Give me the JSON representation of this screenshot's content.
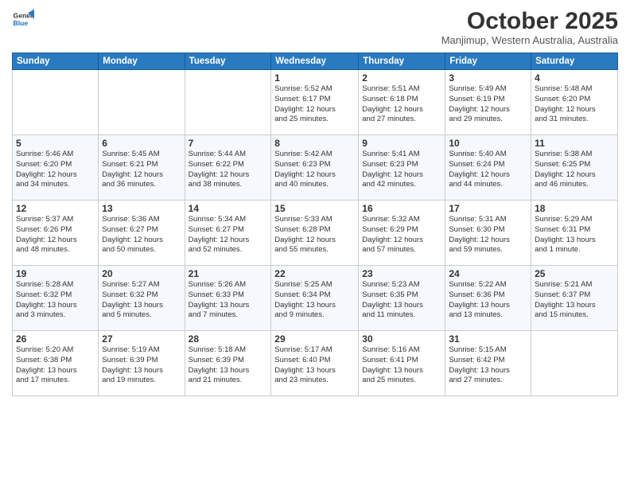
{
  "logo": {
    "line1": "General",
    "line2": "Blue"
  },
  "title": "October 2025",
  "location": "Manjimup, Western Australia, Australia",
  "weekdays": [
    "Sunday",
    "Monday",
    "Tuesday",
    "Wednesday",
    "Thursday",
    "Friday",
    "Saturday"
  ],
  "weeks": [
    [
      {
        "day": "",
        "info": ""
      },
      {
        "day": "",
        "info": ""
      },
      {
        "day": "",
        "info": ""
      },
      {
        "day": "1",
        "info": "Sunrise: 5:52 AM\nSunset: 6:17 PM\nDaylight: 12 hours\nand 25 minutes."
      },
      {
        "day": "2",
        "info": "Sunrise: 5:51 AM\nSunset: 6:18 PM\nDaylight: 12 hours\nand 27 minutes."
      },
      {
        "day": "3",
        "info": "Sunrise: 5:49 AM\nSunset: 6:19 PM\nDaylight: 12 hours\nand 29 minutes."
      },
      {
        "day": "4",
        "info": "Sunrise: 5:48 AM\nSunset: 6:20 PM\nDaylight: 12 hours\nand 31 minutes."
      }
    ],
    [
      {
        "day": "5",
        "info": "Sunrise: 5:46 AM\nSunset: 6:20 PM\nDaylight: 12 hours\nand 34 minutes."
      },
      {
        "day": "6",
        "info": "Sunrise: 5:45 AM\nSunset: 6:21 PM\nDaylight: 12 hours\nand 36 minutes."
      },
      {
        "day": "7",
        "info": "Sunrise: 5:44 AM\nSunset: 6:22 PM\nDaylight: 12 hours\nand 38 minutes."
      },
      {
        "day": "8",
        "info": "Sunrise: 5:42 AM\nSunset: 6:23 PM\nDaylight: 12 hours\nand 40 minutes."
      },
      {
        "day": "9",
        "info": "Sunrise: 5:41 AM\nSunset: 6:23 PM\nDaylight: 12 hours\nand 42 minutes."
      },
      {
        "day": "10",
        "info": "Sunrise: 5:40 AM\nSunset: 6:24 PM\nDaylight: 12 hours\nand 44 minutes."
      },
      {
        "day": "11",
        "info": "Sunrise: 5:38 AM\nSunset: 6:25 PM\nDaylight: 12 hours\nand 46 minutes."
      }
    ],
    [
      {
        "day": "12",
        "info": "Sunrise: 5:37 AM\nSunset: 6:26 PM\nDaylight: 12 hours\nand 48 minutes."
      },
      {
        "day": "13",
        "info": "Sunrise: 5:36 AM\nSunset: 6:27 PM\nDaylight: 12 hours\nand 50 minutes."
      },
      {
        "day": "14",
        "info": "Sunrise: 5:34 AM\nSunset: 6:27 PM\nDaylight: 12 hours\nand 52 minutes."
      },
      {
        "day": "15",
        "info": "Sunrise: 5:33 AM\nSunset: 6:28 PM\nDaylight: 12 hours\nand 55 minutes."
      },
      {
        "day": "16",
        "info": "Sunrise: 5:32 AM\nSunset: 6:29 PM\nDaylight: 12 hours\nand 57 minutes."
      },
      {
        "day": "17",
        "info": "Sunrise: 5:31 AM\nSunset: 6:30 PM\nDaylight: 12 hours\nand 59 minutes."
      },
      {
        "day": "18",
        "info": "Sunrise: 5:29 AM\nSunset: 6:31 PM\nDaylight: 13 hours\nand 1 minute."
      }
    ],
    [
      {
        "day": "19",
        "info": "Sunrise: 5:28 AM\nSunset: 6:32 PM\nDaylight: 13 hours\nand 3 minutes."
      },
      {
        "day": "20",
        "info": "Sunrise: 5:27 AM\nSunset: 6:32 PM\nDaylight: 13 hours\nand 5 minutes."
      },
      {
        "day": "21",
        "info": "Sunrise: 5:26 AM\nSunset: 6:33 PM\nDaylight: 13 hours\nand 7 minutes."
      },
      {
        "day": "22",
        "info": "Sunrise: 5:25 AM\nSunset: 6:34 PM\nDaylight: 13 hours\nand 9 minutes."
      },
      {
        "day": "23",
        "info": "Sunrise: 5:23 AM\nSunset: 6:35 PM\nDaylight: 13 hours\nand 11 minutes."
      },
      {
        "day": "24",
        "info": "Sunrise: 5:22 AM\nSunset: 6:36 PM\nDaylight: 13 hours\nand 13 minutes."
      },
      {
        "day": "25",
        "info": "Sunrise: 5:21 AM\nSunset: 6:37 PM\nDaylight: 13 hours\nand 15 minutes."
      }
    ],
    [
      {
        "day": "26",
        "info": "Sunrise: 5:20 AM\nSunset: 6:38 PM\nDaylight: 13 hours\nand 17 minutes."
      },
      {
        "day": "27",
        "info": "Sunrise: 5:19 AM\nSunset: 6:39 PM\nDaylight: 13 hours\nand 19 minutes."
      },
      {
        "day": "28",
        "info": "Sunrise: 5:18 AM\nSunset: 6:39 PM\nDaylight: 13 hours\nand 21 minutes."
      },
      {
        "day": "29",
        "info": "Sunrise: 5:17 AM\nSunset: 6:40 PM\nDaylight: 13 hours\nand 23 minutes."
      },
      {
        "day": "30",
        "info": "Sunrise: 5:16 AM\nSunset: 6:41 PM\nDaylight: 13 hours\nand 25 minutes."
      },
      {
        "day": "31",
        "info": "Sunrise: 5:15 AM\nSunset: 6:42 PM\nDaylight: 13 hours\nand 27 minutes."
      },
      {
        "day": "",
        "info": ""
      }
    ]
  ]
}
